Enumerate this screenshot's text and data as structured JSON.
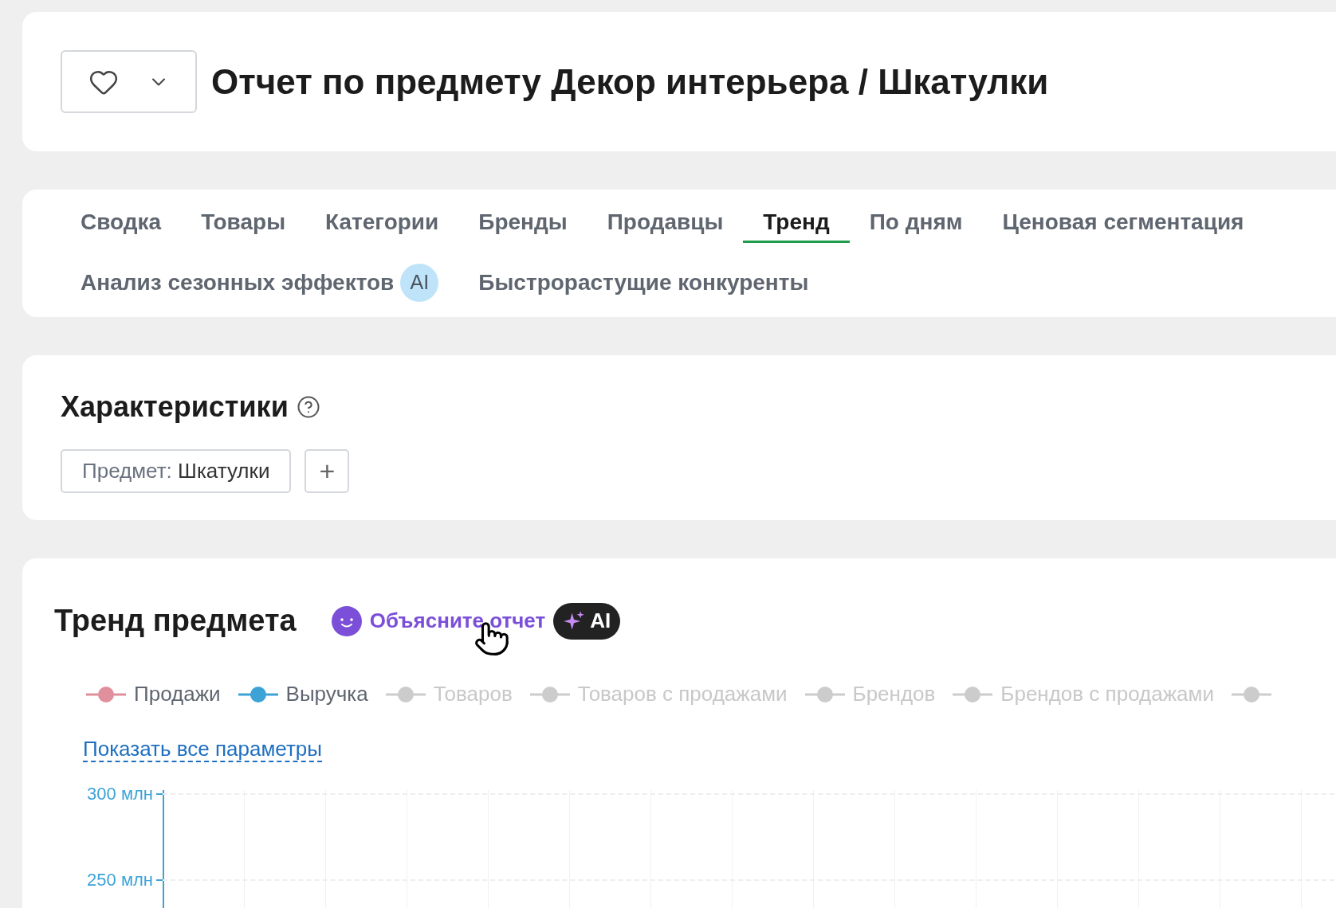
{
  "header": {
    "title": "Отчет по предмету Декор интерьера / Шкатулки",
    "favorite": false
  },
  "tabs": [
    {
      "label": "Сводка",
      "selected": false
    },
    {
      "label": "Товары",
      "selected": false
    },
    {
      "label": "Категории",
      "selected": false
    },
    {
      "label": "Бренды",
      "selected": false
    },
    {
      "label": "Продавцы",
      "selected": false
    },
    {
      "label": "Тренд",
      "selected": true
    },
    {
      "label": "По дням",
      "selected": false
    },
    {
      "label": "Ценовая сегментация",
      "selected": false
    },
    {
      "label": "Анализ сезонных эффектов",
      "badge": "AI",
      "selected": false
    },
    {
      "label": "Быстрорастущие конкуренты",
      "selected": false
    }
  ],
  "characteristics": {
    "title": "Характеристики",
    "filters": [
      {
        "name": "Предмет:",
        "value": "Шкатулки"
      }
    ],
    "add_button": "+"
  },
  "trend": {
    "title": "Тренд предмета",
    "explain_link": "Объясните отчет",
    "ai_badge": "AI",
    "legend": [
      {
        "label": "Продажи",
        "enabled": true,
        "color": "#e0909c"
      },
      {
        "label": "Выручка",
        "enabled": true,
        "color": "#3da3d6"
      },
      {
        "label": "Товаров",
        "enabled": false
      },
      {
        "label": "Товаров с продажами",
        "enabled": false
      },
      {
        "label": "Брендов",
        "enabled": false
      },
      {
        "label": "Брендов с продажами",
        "enabled": false
      },
      {
        "enabled": false
      }
    ],
    "show_all_link": "Показать все параметры",
    "y_ticks": [
      "300 млн",
      "250 млн"
    ]
  }
}
